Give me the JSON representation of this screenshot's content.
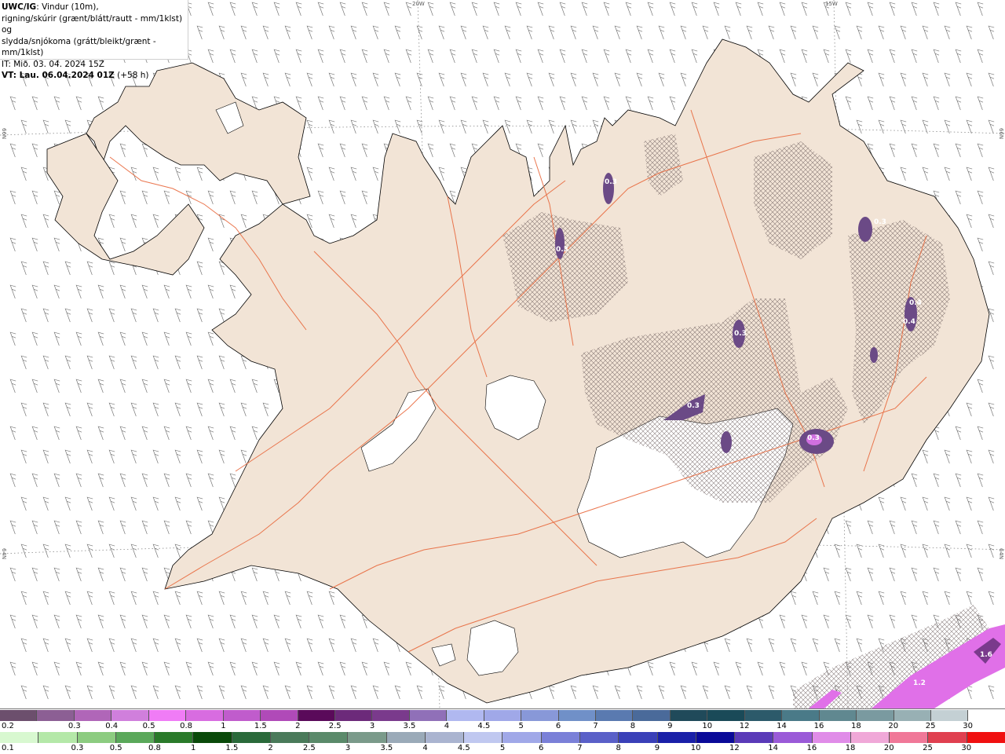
{
  "info": {
    "line1_bold": "UWC/IG",
    "line1_rest": ": Vindur (10m),",
    "line2": "rigning/skúrir (grænt/blátt/rautt - mm/1klst) og",
    "line3": "slydda/snjókoma (grátt/bleikt/grænt - mm/1klst)",
    "line4": "IT: Mið. 03. 04. 2024 15Z",
    "line5_bold": "VT: Lau. 06.04.2024 01Z",
    "line5_rest": " (+58 h)"
  },
  "coords": {
    "top_w20": "20W",
    "top_w15": "15W",
    "left_66n": "66N",
    "right_66n": "66N",
    "left_64n": "64N",
    "right_64n": "64N"
  },
  "colors": {
    "land": "#f2e4d6",
    "coast": "#000000",
    "roads": "#e8683c",
    "glacier": "#ffffff",
    "sea": "#ffffff",
    "wind_barb": "#777777",
    "precip_dark": "#6b4a86",
    "precip_pink": "#e070e8"
  },
  "precip_labels": [
    "0.3",
    "0.3",
    "0.3",
    "0.3",
    "0.3",
    "0.4",
    "0.4",
    "0.3",
    "1.2",
    "1.6"
  ],
  "scale_snow": {
    "labels": [
      "0.2",
      "0.3",
      "0.4",
      "0.5",
      "0.8",
      "1",
      "1.5",
      "2",
      "2.5",
      "3",
      "3.5",
      "4",
      "4.5",
      "5",
      "6",
      "7",
      "8",
      "9",
      "10",
      "12",
      "14",
      "16",
      "18",
      "20",
      "25",
      "30"
    ],
    "colors": [
      "#6c4f6d",
      "#8c5f94",
      "#b066b8",
      "#d07fdc",
      "#f07cf6",
      "#d86ce0",
      "#c05ccc",
      "#b04ab8",
      "#5a0a5a",
      "#6c2a7a",
      "#7a3a8c",
      "#9070b8",
      "#b0b8f0",
      "#a0a8e8",
      "#8898d8",
      "#7090c8",
      "#5a7ab0",
      "#4a6a9a",
      "#204a5a",
      "#1a4a58",
      "#2c5a6a",
      "#4a7a88",
      "#608890",
      "#7a9aa0",
      "#98b0b4",
      "#c4d0d4",
      "#ffffff"
    ]
  },
  "scale_rain": {
    "labels": [
      "0.1",
      "0.3",
      "0.5",
      "0.8",
      "1",
      "1.5",
      "2",
      "2.5",
      "3",
      "3.5",
      "4",
      "4.5",
      "5",
      "6",
      "7",
      "8",
      "9",
      "10",
      "12",
      "14",
      "16",
      "18",
      "20",
      "25",
      "30"
    ],
    "colors": [
      "#d8f8d0",
      "#b4e8a8",
      "#8ccc80",
      "#5aa85a",
      "#2a7a2a",
      "#0a4a0a",
      "#2a6a3a",
      "#4a7a5a",
      "#5a8a6a",
      "#7a9a8a",
      "#9aaab8",
      "#aab4d0",
      "#c0c8f0",
      "#a0a8e8",
      "#7a80d8",
      "#5a60c8",
      "#3a40b8",
      "#1a20a8",
      "#0a0a98",
      "#5a3ab8",
      "#9a5ad8",
      "#e08ce8",
      "#f0a8d8",
      "#f07898",
      "#e04050",
      "#f01010"
    ]
  }
}
